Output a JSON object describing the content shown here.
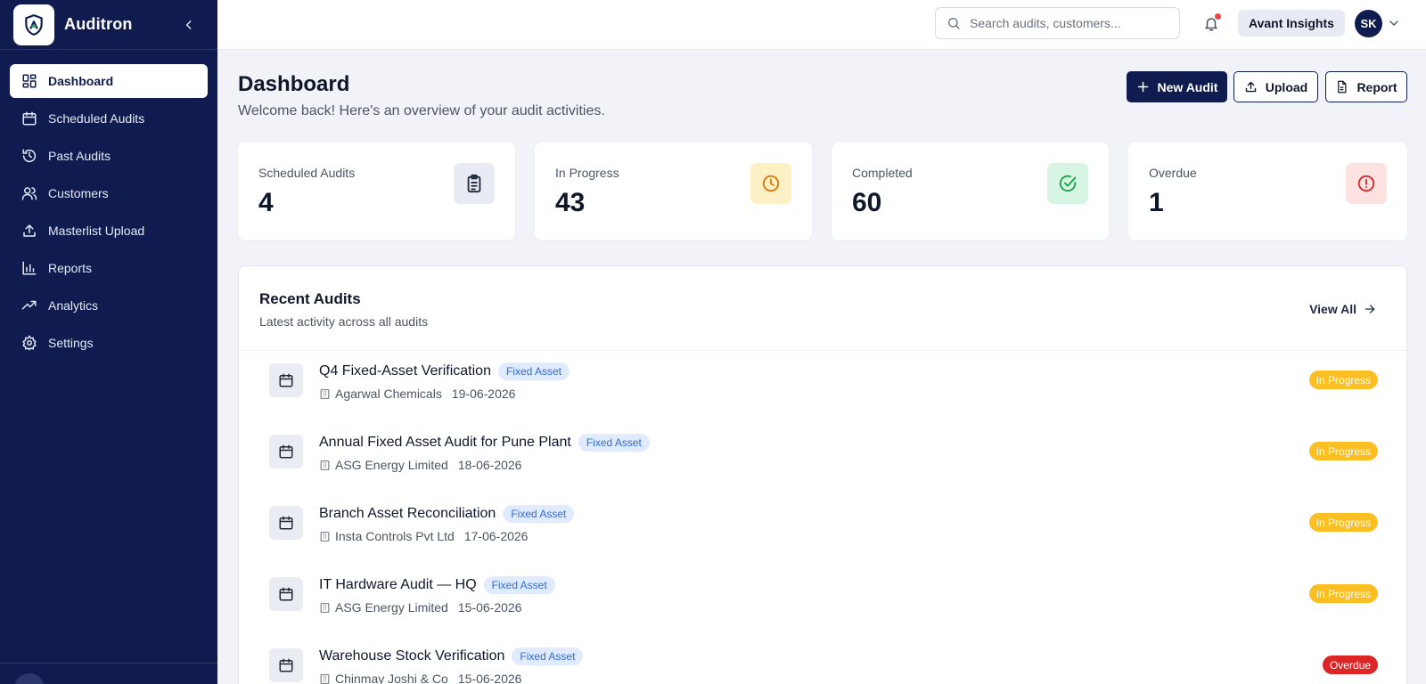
{
  "app": {
    "name": "Auditron"
  },
  "nav": {
    "items": [
      {
        "label": "Dashboard",
        "icon": "dashboard-icon",
        "active": true
      },
      {
        "label": "Scheduled Audits",
        "icon": "calendar-icon"
      },
      {
        "label": "Past Audits",
        "icon": "history-icon"
      },
      {
        "label": "Customers",
        "icon": "users-icon"
      },
      {
        "label": "Masterlist Upload",
        "icon": "upload-icon"
      },
      {
        "label": "Reports",
        "icon": "bar-chart-icon"
      },
      {
        "label": "Analytics",
        "icon": "trending-up-icon"
      },
      {
        "label": "Settings",
        "icon": "settings-icon"
      }
    ]
  },
  "topbar": {
    "search_placeholder": "Search audits, customers...",
    "org": "Avant Insights",
    "avatar_initials": "SK"
  },
  "header": {
    "title": "Dashboard",
    "subtitle": "Welcome back! Here's an overview of your audit activities.",
    "new_audit_label": "New Audit",
    "upload_label": "Upload",
    "report_label": "Report"
  },
  "stats": [
    {
      "label": "Scheduled Audits",
      "value": "4",
      "icon": "clipboard-icon",
      "color": "#1e293b",
      "bg": "#e8ebf3"
    },
    {
      "label": "In Progress",
      "value": "43",
      "icon": "clock-icon",
      "color": "#d97706",
      "bg": "#fdf0c4"
    },
    {
      "label": "Completed",
      "value": "60",
      "icon": "check-circle-icon",
      "color": "#16a34a",
      "bg": "#d7f5e3"
    },
    {
      "label": "Overdue",
      "value": "1",
      "icon": "alert-circle-icon",
      "color": "#dc2626",
      "bg": "#fde2e2"
    }
  ],
  "recent": {
    "title": "Recent Audits",
    "subtitle": "Latest activity across all audits",
    "view_all_label": "View All",
    "items": [
      {
        "title": "Q4 Fixed-Asset Verification",
        "tag": "Fixed Asset",
        "customer": "Agarwal Chemicals",
        "date": "19-06-2026",
        "status": "In Progress"
      },
      {
        "title": "Annual Fixed Asset Audit for Pune Plant",
        "tag": "Fixed Asset",
        "customer": "ASG Energy Limited",
        "date": "18-06-2026",
        "status": "In Progress"
      },
      {
        "title": "Branch Asset Reconciliation",
        "tag": "Fixed Asset",
        "customer": "Insta Controls Pvt Ltd",
        "date": "17-06-2026",
        "status": "In Progress"
      },
      {
        "title": "IT Hardware Audit — HQ",
        "tag": "Fixed Asset",
        "customer": "ASG Energy Limited",
        "date": "15-06-2026",
        "status": "In Progress"
      },
      {
        "title": "Warehouse Stock Verification",
        "tag": "Fixed Asset",
        "customer": "Chinmay Joshi & Co",
        "date": "15-06-2026",
        "status": "Overdue"
      }
    ]
  },
  "colors": {
    "sidebar": "#101c4f",
    "status_in_progress": "#fbbf24",
    "status_overdue": "#dc2626",
    "tag_bg": "#e0ebff",
    "tag_text": "#2f6ad9"
  }
}
